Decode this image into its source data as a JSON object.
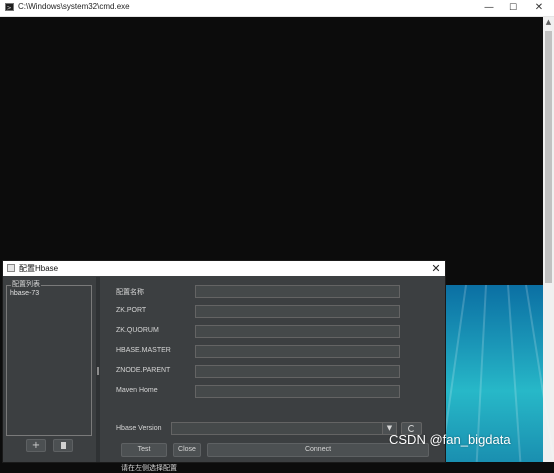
{
  "cmd": {
    "title": "C:\\Windows\\system32\\cmd.exe",
    "icon": "cmd-icon",
    "controls": {
      "minimize": "—",
      "maximize": "☐",
      "close": "✕"
    }
  },
  "dialog": {
    "title": "配置Hbase",
    "close": "✕",
    "config_list": {
      "legend": "配置列表",
      "items": [
        "hbase-73"
      ]
    },
    "add_label": "+",
    "fields": [
      {
        "label": "配置名称",
        "value": ""
      },
      {
        "label": "ZK.PORT",
        "value": ""
      },
      {
        "label": "ZK.QUORUM",
        "value": ""
      },
      {
        "label": "HBASE.MASTER",
        "value": ""
      },
      {
        "label": "ZNODE.PARENT",
        "value": ""
      },
      {
        "label": "Maven Home",
        "value": ""
      }
    ],
    "version": {
      "label": "Hbase Version",
      "selected": "",
      "arrow": "▼"
    },
    "buttons": {
      "test": "Test",
      "close": "Close",
      "connect": "Connect"
    },
    "status": "请在左侧选择配置"
  },
  "watermark": "CSDN @fan_bigdata"
}
